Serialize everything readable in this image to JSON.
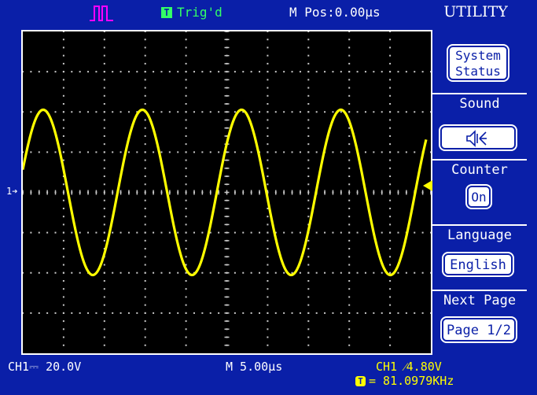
{
  "header": {
    "pulse_icon": "pulse-waveform-icon",
    "trig_badge": "T",
    "trig_status": "Trig'd",
    "m_pos": "M Pos:0.00µs",
    "menu_title": "UTILITY"
  },
  "waveform": {
    "channel_marker": "1",
    "color": "#ffff00",
    "shape": "sine",
    "cycles_visible": 4
  },
  "menu": {
    "system_status_line1": "System",
    "system_status_line2": "Status",
    "sound_label": "Sound",
    "sound_icon": "speaker-icon",
    "counter_label": "Counter",
    "counter_value": "On",
    "language_label": "Language",
    "language_value": "English",
    "next_page_label": "Next Page",
    "page_value": "Page 1/2"
  },
  "footer": {
    "ch1_scale": "CH1⎓ 20.0V",
    "timebase": "M 5.00µs",
    "trigger_level": "CH1 ⁄4.80V",
    "freq_badge": "T",
    "frequency": "= 81.0979KHz"
  },
  "colors": {
    "background": "#0a1fa8",
    "screen": "#000000",
    "trace": "#ffff00",
    "trig_status": "#33ff66",
    "pulse_icon": "#ff00ff"
  }
}
